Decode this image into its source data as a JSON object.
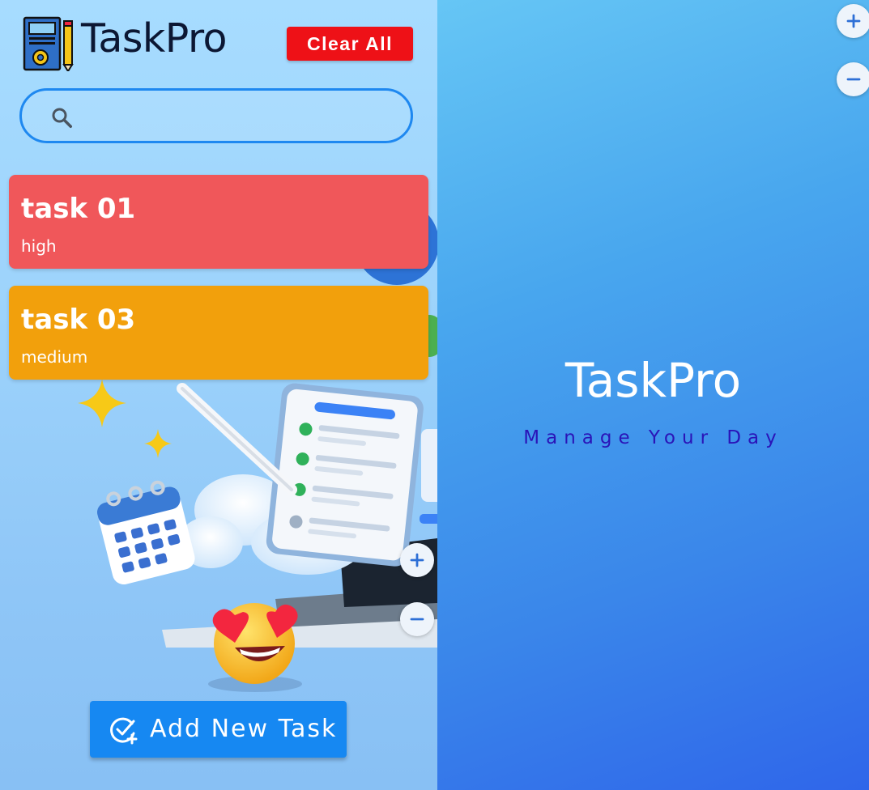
{
  "app": {
    "name": "TaskPro",
    "clear_all_label": "Clear All"
  },
  "search": {
    "placeholder": "",
    "value": ""
  },
  "tasks": [
    {
      "title": "task 01",
      "priority": "high",
      "color": "#f0575a"
    },
    {
      "title": "task 03",
      "priority": "medium",
      "color": "#f2a00c"
    }
  ],
  "add_button": {
    "label": "Add New Task"
  },
  "splash": {
    "title": "TaskPro",
    "subtitle": "Manage Your Day"
  },
  "icons": {
    "logo": "taskpro-logo-icon",
    "search": "search-icon",
    "add_task": "add-task-icon",
    "zoom_in": "plus-icon",
    "zoom_out": "minus-icon"
  },
  "colors": {
    "accent": "#1688f2",
    "danger": "#ee1117",
    "subtitle": "#2a14b8"
  }
}
